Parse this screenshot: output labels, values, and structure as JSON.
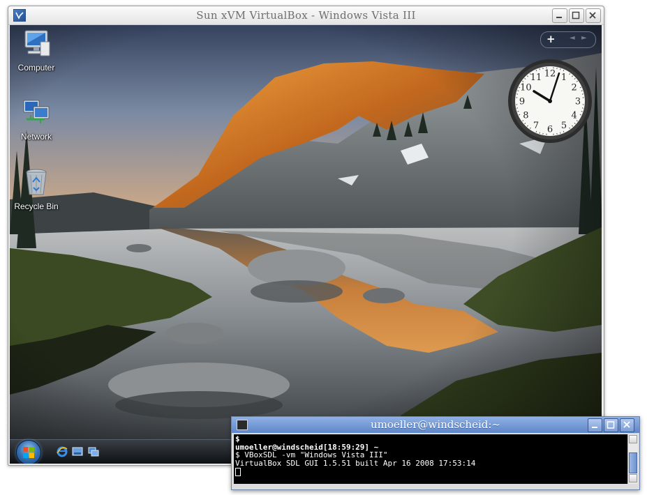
{
  "vbox_window": {
    "title": "Sun xVM VirtualBox - Windows Vista III",
    "controls": [
      "minimize",
      "maximize",
      "close"
    ]
  },
  "desktop": {
    "icons": [
      {
        "label": "Computer",
        "icon": "computer-icon"
      },
      {
        "label": "Network",
        "icon": "network-icon"
      },
      {
        "label": "Recycle Bin",
        "icon": "recycle-bin-icon"
      }
    ],
    "gadget_toolbar": {
      "add": "+",
      "prev": "◄",
      "next": "►"
    },
    "clock": {
      "hour": 10,
      "minute": 3
    },
    "taskbar": {
      "start": "start-orb-icon",
      "quick_launch": [
        "internet-explorer-icon",
        "show-desktop-icon",
        "switch-windows-icon"
      ]
    }
  },
  "terminal": {
    "title": "umoeller@windscheid:~",
    "lines": [
      {
        "text": "$",
        "bold": true
      },
      {
        "text": "umoeller@windscheid[18:59:29] ~",
        "bold": true
      },
      {
        "text": "$ VBoxSDL -vm \"Windows Vista III\"",
        "bold": false
      },
      {
        "text": "VirtualBox SDL GUI 1.5.51 built Apr 16 2008 17:53:14",
        "bold": false
      }
    ]
  },
  "colors": {
    "terminal_titlebar": "#7297d6",
    "terminal_background": "#000000",
    "terminal_text": "#ffffff",
    "vbox_title_text": "#6e6e6e"
  }
}
